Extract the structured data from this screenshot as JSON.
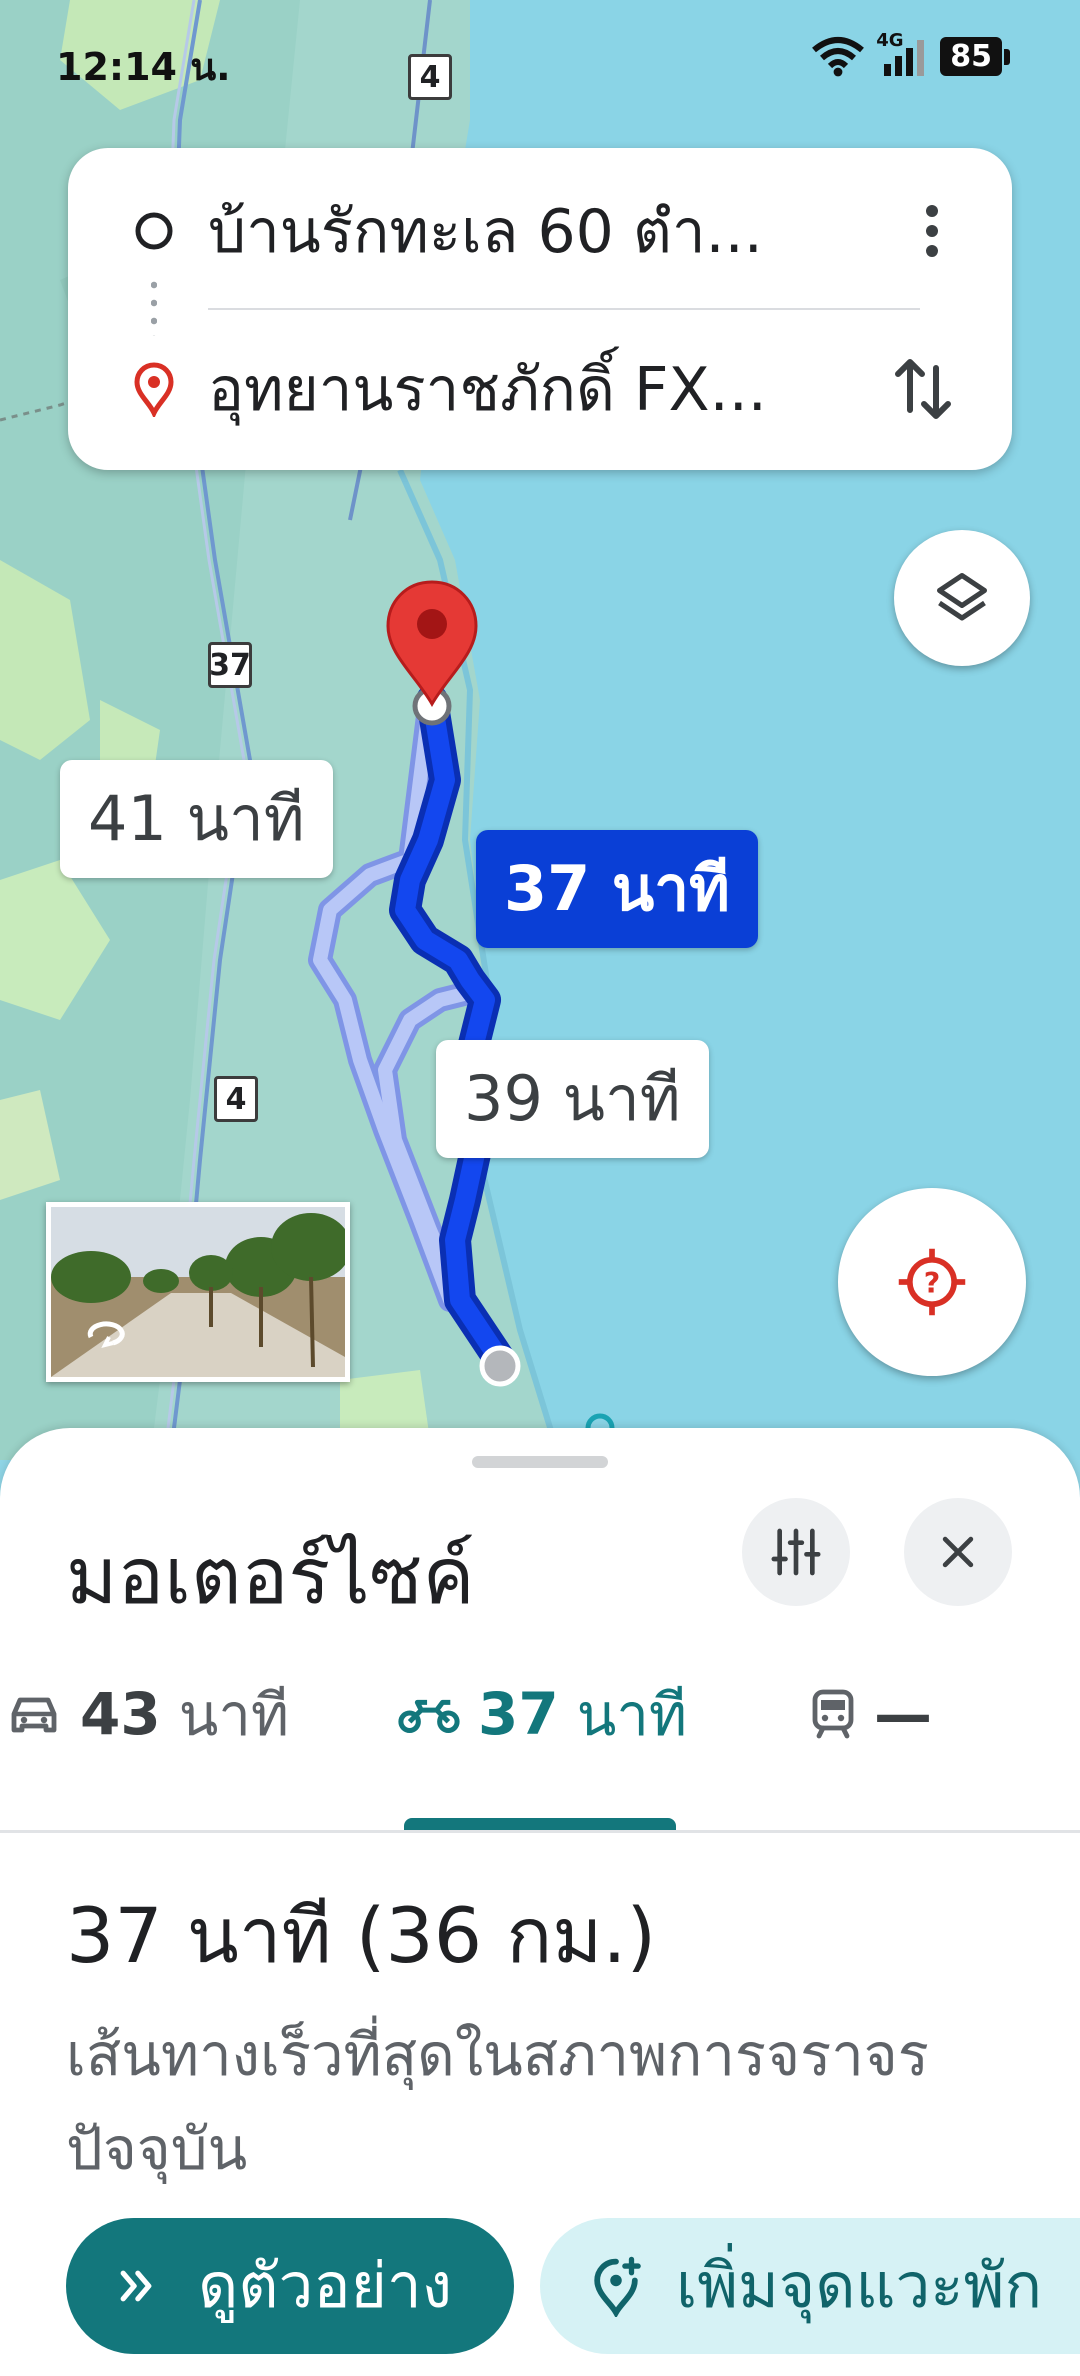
{
  "status_bar": {
    "time": "12:14 น.",
    "network": "4G",
    "battery": "85"
  },
  "map": {
    "road_shields": [
      "4",
      "37",
      "4"
    ],
    "route_labels": {
      "alt_1": "41 นาที",
      "selected": "37 นาที",
      "alt_2": "39 นาที"
    },
    "colors": {
      "water": "#8ad4e6",
      "land": "#a9d8cf",
      "route_selected": "#0b3ee0",
      "route_alternative": "#a8b8f4"
    }
  },
  "search": {
    "origin": "บ้านรักทะเล 60 ตำ...",
    "destination": "อุทยานราชภักดิ์ FX..."
  },
  "sheet": {
    "title": "มอเตอร์ไซค์",
    "modes": [
      {
        "icon": "car-icon",
        "value": "43",
        "unit": "นาที"
      },
      {
        "icon": "motorcycle-icon",
        "value": "37",
        "unit": "นาที",
        "active": true
      },
      {
        "icon": "train-icon",
        "value": "—",
        "unit": ""
      }
    ],
    "summary": "37 นาที (36 กม.)",
    "description": "เส้นทางเร็วที่สุดในสภาพการจราจรปัจจุบัน",
    "buttons": {
      "preview": "ดูตัวอย่าง",
      "add_stop": "เพิ่มจุดแวะพัก"
    },
    "accent": "#13777c"
  }
}
